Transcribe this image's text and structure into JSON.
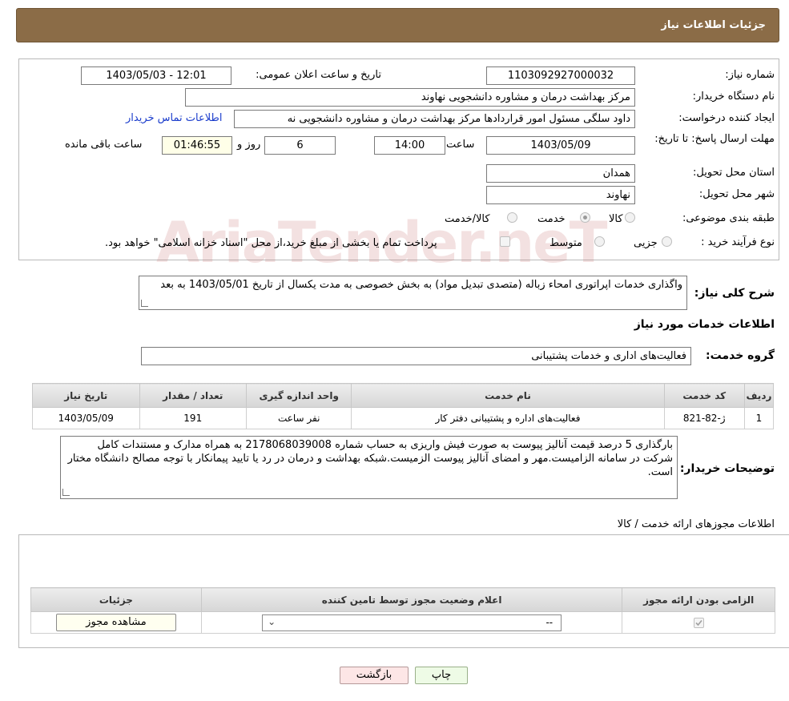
{
  "header": {
    "title": "جزئیات اطلاعات نیاز"
  },
  "form": {
    "need_number_label": "شماره نیاز:",
    "need_number": "1103092927000032",
    "announce_label": "تاریخ و ساعت اعلان عمومی:",
    "announce_value": "1403/05/03 - 12:01",
    "buyer_org_label": "نام دستگاه خریدار:",
    "buyer_org": "مرکز بهداشت  درمان و مشاوره دانشجویی نهاوند",
    "creator_label": "ایجاد کننده درخواست:",
    "creator": "داود سلگی مسئول امور قراردادها مرکز بهداشت  درمان و مشاوره دانشجویی نه",
    "contact_link": "اطلاعات تماس خریدار",
    "deadline_label": "مهلت ارسال پاسخ: تا تاریخ:",
    "deadline_date": "1403/05/09",
    "time_label": "ساعت",
    "deadline_time": "14:00",
    "days_value": "6",
    "days_label": "روز و",
    "remaining_time": "01:46:55",
    "remaining_label": "ساعت باقی مانده",
    "province_label": "استان محل تحویل:",
    "province": "همدان",
    "city_label": "شهر محل تحویل:",
    "city": "نهاوند",
    "category_label": "طبقه بندی موضوعی:",
    "category_options": [
      "کالا",
      "خدمت",
      "کالا/خدمت"
    ],
    "category_selected": "خدمت",
    "process_label": "نوع فرآیند خرید :",
    "process_options": [
      "جزیی",
      "متوسط"
    ],
    "payment_note": "پرداخت تمام یا بخشی از مبلغ خرید،از محل \"اسناد خزانه اسلامی\" خواهد بود.",
    "summary_label": "شرح کلی نیاز:",
    "summary": "واگذاری خدمات اپراتوری امحاء زباله (متصدی تبدیل مواد) به بخش خصوصی به مدت یکسال از تاریخ 1403/05/01 به بعد"
  },
  "services": {
    "section_title": "اطلاعات خدمات مورد نیاز",
    "group_label": "گروه خدمت:",
    "group_value": "فعالیت‌های اداری و خدمات پشتیبانی",
    "columns": [
      "ردیف",
      "کد خدمت",
      "نام خدمت",
      "واحد اندازه گیری",
      "تعداد / مقدار",
      "تاریخ نیاز"
    ],
    "rows": [
      [
        "1",
        "ژ-82-821",
        "فعالیت‌های اداره و پشتیبانی دفتر کار",
        "نفر ساعت",
        "191",
        "1403/05/09"
      ]
    ]
  },
  "buyer_notes": {
    "label": "توضیحات خریدار:",
    "text": "بارگذاری 5 درصد قیمت آنالیز پیوست به صورت فیش واریزی به حساب شماره 2178068039008 به همراه مدارک و مستندات کامل شرکت در سامانه الزامیست.مهر و امضای آنالیز پیوست الزمیست.شبکه بهداشت و درمان در رد یا تایید پیمانکار با توجه مصالح دانشگاه مختار است."
  },
  "permits": {
    "section_title": "اطلاعات مجوزهای ارائه خدمت / کالا",
    "columns": [
      "الزامی بودن ارائه مجوز",
      "اعلام وضعیت مجوز توسط تامین کننده",
      "جزئیات"
    ],
    "select_value": "--",
    "view_button": "مشاهده مجوز"
  },
  "buttons": {
    "print": "چاپ",
    "back": "بازگشت"
  },
  "watermark": "AriaTender.neT"
}
